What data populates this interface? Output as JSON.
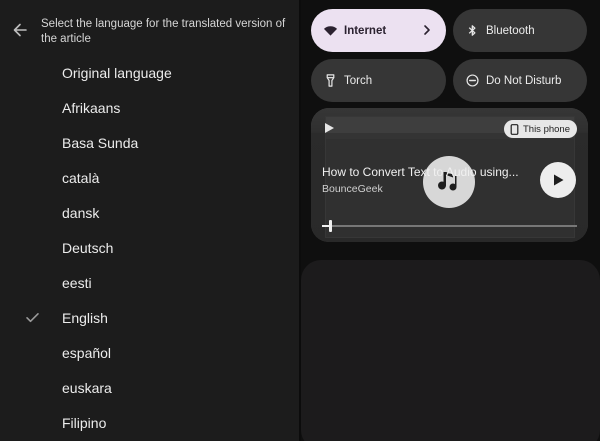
{
  "language_picker": {
    "header": "Select the language for the translated version of the article",
    "selected_index": 7,
    "languages": [
      "Original language",
      "Afrikaans",
      "Basa Sunda",
      "català",
      "dansk",
      "Deutsch",
      "eesti",
      "English",
      "español",
      "euskara",
      "Filipino"
    ]
  },
  "quick_settings": {
    "tiles": [
      {
        "label": "Internet",
        "icon": "wifi-icon",
        "active": true,
        "has_chevron": true
      },
      {
        "label": "Bluetooth",
        "icon": "bluetooth-icon",
        "active": false
      },
      {
        "label": "Torch",
        "icon": "flashlight-icon",
        "active": false
      },
      {
        "label": "Do Not Disturb",
        "icon": "do-not-disturb-icon",
        "active": false
      }
    ]
  },
  "media_player": {
    "title": "How to Convert Text to Audio using...",
    "artist": "BounceGeek",
    "output_device": "This phone",
    "progress": 0.03
  },
  "colors": {
    "active_tile": "#ece1f1",
    "tile": "#363636",
    "panel_left": "#1c1c1c",
    "panel_right": "#0f0f0f"
  }
}
